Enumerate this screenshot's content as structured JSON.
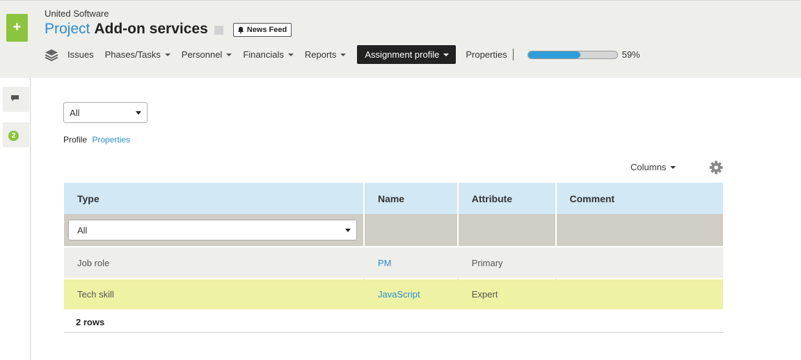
{
  "header": {
    "company": "United Software",
    "project_word": "Project",
    "project_name": "Add-on services",
    "news_feed_label": "News Feed",
    "add_label": "+"
  },
  "nav": {
    "items": [
      {
        "label": "Issues",
        "dropdown": false
      },
      {
        "label": "Phases/Tasks",
        "dropdown": true
      },
      {
        "label": "Personnel",
        "dropdown": true
      },
      {
        "label": "Financials",
        "dropdown": true
      },
      {
        "label": "Reports",
        "dropdown": true
      },
      {
        "label": "Assignment profile",
        "dropdown": true,
        "active": true
      },
      {
        "label": "Properties",
        "dropdown": false
      }
    ],
    "progress_percent": 59,
    "progress_label": "59%"
  },
  "rail": {
    "badge_count": "2"
  },
  "main": {
    "filter_value": "All",
    "subtabs": {
      "active": "Profile",
      "link": "Properties"
    },
    "columns_label": "Columns"
  },
  "table": {
    "headers": [
      "Type",
      "Name",
      "Attribute",
      "Comment"
    ],
    "type_filter_value": "All",
    "rows": [
      {
        "type": "Job role",
        "name": "PM",
        "attribute": "Primary",
        "comment": ""
      },
      {
        "type": "Tech skill",
        "name": "JavaScript",
        "attribute": "Expert",
        "comment": ""
      }
    ],
    "row_count_label": "2 rows"
  },
  "colors": {
    "accent_green": "#8cc43e",
    "link_blue": "#2a8ed6",
    "header_blue": "#d2e8f4",
    "highlight_row": "#eef2a3",
    "progress_fill": "#2e9ed8"
  }
}
